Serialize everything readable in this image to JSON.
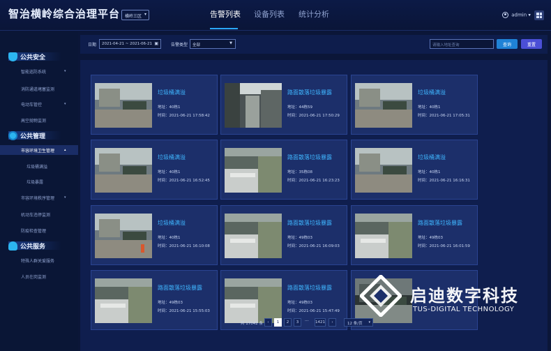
{
  "header": {
    "app_title": "智治横岭综合治理平台",
    "area_select": "横岭三区",
    "tabs": [
      {
        "label": "告警列表",
        "active": true
      },
      {
        "label": "设备列表",
        "active": false
      },
      {
        "label": "统计分析",
        "active": false
      }
    ],
    "user": "admin"
  },
  "sidebar": {
    "groups": [
      {
        "title": "公共安全",
        "icon": "shield-icon"
      },
      {
        "title": "公共管理",
        "icon": "gear-icon"
      },
      {
        "title": "公共服务",
        "icon": "hands-icon"
      }
    ],
    "items": [
      {
        "label": "智能巡防系统",
        "has_arrow": true
      },
      {
        "label": "消防通道堵塞监测",
        "has_arrow": false
      },
      {
        "label": "电动车管控",
        "has_arrow": true
      },
      {
        "label": "高空抛物监测",
        "has_arrow": false
      },
      {
        "label": "市容环境卫生管理",
        "has_arrow": true,
        "expanded": true,
        "active": true
      },
      {
        "label": "垃圾桶满溢",
        "sub": true
      },
      {
        "label": "垃圾暴露",
        "sub": true
      },
      {
        "label": "市容环境秩序管理",
        "has_arrow": true
      },
      {
        "label": "机动车违停监测",
        "has_arrow": false
      },
      {
        "label": "防疫检查管理",
        "has_arrow": false
      },
      {
        "label": "特殊人群关爱服务",
        "has_arrow": false
      },
      {
        "label": "人员在岗监测",
        "has_arrow": false
      }
    ]
  },
  "filters": {
    "date_label": "日期",
    "date_range": "2021-04-21 ~ 2021-06-21",
    "type_label": "告警类型",
    "type_value": "全部",
    "search_placeholder": "请输入地址查询",
    "query_button": "查询",
    "reset_button": "重置"
  },
  "alarms": [
    {
      "title": "垃圾桶满溢",
      "address": "地址：40栋1",
      "time": "时间：2021-06-21 17:58:42",
      "scene": "bins"
    },
    {
      "title": "路面散落垃圾暴露",
      "address": "地址：44栋59",
      "time": "时间：2021-06-21 17:50:29",
      "scene": "street"
    },
    {
      "title": "垃圾桶满溢",
      "address": "地址：40栋1",
      "time": "时间：2021-06-21 17:05:31",
      "scene": "bins"
    },
    {
      "title": "垃圾桶满溢",
      "address": "地址：40栋1",
      "time": "时间：2021-06-21 16:52:45",
      "scene": "bins"
    },
    {
      "title": "路面散落垃圾暴露",
      "address": "地址：35栋08",
      "time": "时间：2021-06-21 16:23:23",
      "scene": "lot"
    },
    {
      "title": "垃圾桶满溢",
      "address": "地址：40栋1",
      "time": "时间：2021-06-21 16:16:31",
      "scene": "bins"
    },
    {
      "title": "垃圾桶满溢",
      "address": "地址：40栋1",
      "time": "时间：2021-06-21 16:10:08",
      "scene": "bins-person"
    },
    {
      "title": "路面散落垃圾暴露",
      "address": "地址：49栋03",
      "time": "时间：2021-06-21 16:09:03",
      "scene": "lot"
    },
    {
      "title": "路面散落垃圾暴露",
      "address": "地址：49栋03",
      "time": "时间：2021-06-21 16:01:59",
      "scene": "lot"
    },
    {
      "title": "路面散落垃圾暴露",
      "address": "地址：49栋03",
      "time": "时间：2021-06-21 15:55:03",
      "scene": "lot"
    },
    {
      "title": "路面散落垃圾暴露",
      "address": "地址：49栋03",
      "time": "时间：2021-06-21 15:47:49",
      "scene": "lot"
    },
    {
      "title": "",
      "address": "",
      "time": "",
      "scene": "dark"
    }
  ],
  "pagination": {
    "total": "共 17042 条",
    "prev": "‹",
    "pages": [
      "1",
      "2",
      "3"
    ],
    "current": "1",
    "ellipsis": "···",
    "last": "1421",
    "next": "›",
    "page_size": "12 条/页"
  },
  "watermark": {
    "name": "启迪数字科技",
    "english": "TUS-DIGITAL TECHNOLOGY"
  }
}
